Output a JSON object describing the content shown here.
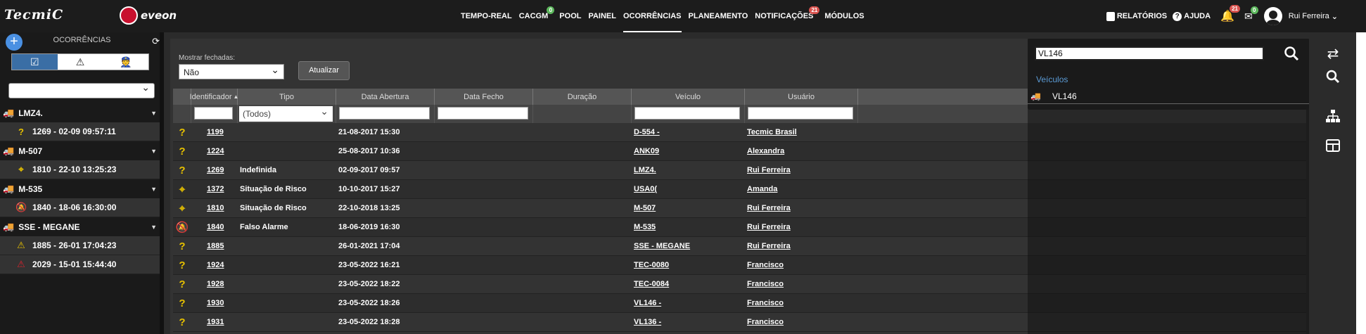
{
  "topbar": {
    "logo_text": "TecmiC",
    "brand_text": "eveon",
    "nav": [
      {
        "label": "TEMPO-REAL"
      },
      {
        "label": "CACGM",
        "badge": "0"
      },
      {
        "label": "POOL"
      },
      {
        "label": "PAINEL"
      },
      {
        "label": "OCORRÊNCIAS",
        "active": true
      },
      {
        "label": "PLANEAMENTO"
      },
      {
        "label": "NOTIFICAÇÕES",
        "badge": "21"
      },
      {
        "label": "MÓDULOS"
      }
    ],
    "reports_label": "RELATÓRIOS",
    "help_label": "AJUDA",
    "bell_badge": "21",
    "mail_badge": "0",
    "user_name": "Rui Ferreira"
  },
  "sidebar": {
    "title": "OCORRÊNCIAS",
    "items": [
      {
        "type": "vehicle",
        "label": "LMZ4."
      },
      {
        "type": "occurrence",
        "icon": "question",
        "label": "1269 - 02-09 09:57:11"
      },
      {
        "type": "vehicle",
        "label": "M-507"
      },
      {
        "type": "occurrence",
        "icon": "crosshair",
        "label": "1810 - 22-10 13:25:23"
      },
      {
        "type": "vehicle",
        "label": "M-535"
      },
      {
        "type": "occurrence",
        "icon": "bell-off",
        "label": "1840 - 18-06 16:30:00"
      },
      {
        "type": "vehicle",
        "label": "SSE - MEGANE"
      },
      {
        "type": "occurrence",
        "icon": "warning",
        "label": "1885 - 26-01 17:04:23"
      },
      {
        "type": "occurrence",
        "icon": "warning-red",
        "label": "2029 - 15-01 15:44:40"
      }
    ]
  },
  "filters": {
    "closed_label": "Mostrar fechadas:",
    "closed_value": "Não",
    "refresh_label": "Atualizar",
    "tipo_value": "(Todos)"
  },
  "table": {
    "headers": [
      "Identificador",
      "Tipo",
      "Data Abertura",
      "Data Fecho",
      "Duração",
      "Veículo",
      "Usuário"
    ],
    "rows": [
      {
        "icon": "question",
        "id": "1199",
        "tipo": "",
        "abertura": "21-08-2017 15:30",
        "veiculo": "D-554 -",
        "usuario": "Tecmic Brasil"
      },
      {
        "icon": "question",
        "id": "1224",
        "tipo": "",
        "abertura": "25-08-2017 10:36",
        "veiculo": "ANK09",
        "usuario": "Alexandra"
      },
      {
        "icon": "question",
        "id": "1269",
        "tipo": "Indefinida",
        "abertura": "02-09-2017 09:57",
        "veiculo": "LMZ4.",
        "usuario": "Rui Ferreira"
      },
      {
        "icon": "crosshair",
        "id": "1372",
        "tipo": "Situação de Risco",
        "abertura": "10-10-2017 15:27",
        "veiculo": "USA0(",
        "usuario": "Amanda"
      },
      {
        "icon": "crosshair",
        "id": "1810",
        "tipo": "Situação de Risco",
        "abertura": "22-10-2018 13:25",
        "veiculo": "M-507",
        "usuario": "Rui Ferreira"
      },
      {
        "icon": "bell-off",
        "id": "1840",
        "tipo": "Falso Alarme",
        "abertura": "18-06-2019 16:30",
        "veiculo": "M-535",
        "usuario": "Rui Ferreira"
      },
      {
        "icon": "question",
        "id": "1885",
        "tipo": "",
        "abertura": "26-01-2021 17:04",
        "veiculo": "SSE - MEGANE",
        "usuario": "Rui Ferreira"
      },
      {
        "icon": "question",
        "id": "1924",
        "tipo": "",
        "abertura": "23-05-2022 16:21",
        "veiculo": "TEC-0080",
        "usuario": "Francisco"
      },
      {
        "icon": "question",
        "id": "1928",
        "tipo": "",
        "abertura": "23-05-2022 18:22",
        "veiculo": "TEC-0084",
        "usuario": "Francisco"
      },
      {
        "icon": "question",
        "id": "1930",
        "tipo": "",
        "abertura": "23-05-2022 18:26",
        "veiculo": "VL146 -",
        "usuario": "Francisco"
      },
      {
        "icon": "question",
        "id": "1931",
        "tipo": "",
        "abertura": "23-05-2022 18:28",
        "veiculo": "VL136 -",
        "usuario": "Francisco"
      }
    ]
  },
  "search_panel": {
    "query": "VL146",
    "category": "Veículos",
    "result": "VL146"
  },
  "colors": {
    "accent_blue": "#4a90e2",
    "link_blue": "#5b9bd5",
    "badge_green": "#5cb85c",
    "badge_red": "#d9534f",
    "warning_yellow": "#e8c200"
  }
}
